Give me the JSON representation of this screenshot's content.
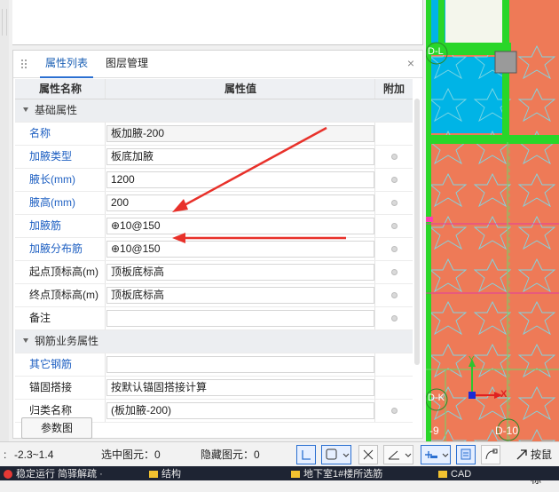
{
  "panel": {
    "tabs": [
      "属性列表",
      "图层管理"
    ],
    "close_glyph": "×",
    "columns": [
      "属性名称",
      "属性值",
      "附加"
    ],
    "sections": [
      {
        "title": "基础属性",
        "rows": [
          {
            "name": "名称",
            "value": "板加腋-200",
            "name_color": "blue",
            "has_dot": false
          },
          {
            "name": "加腋类型",
            "value": "板底加腋",
            "name_color": "blue",
            "has_dot": true
          },
          {
            "name": "腋长(mm)",
            "value": "1200",
            "name_color": "blue",
            "has_dot": true
          },
          {
            "name": "腋高(mm)",
            "value": "200",
            "name_color": "blue",
            "has_dot": true
          },
          {
            "name": "加腋筋",
            "value": "⊕10@150",
            "name_color": "blue",
            "has_dot": true
          },
          {
            "name": "加腋分布筋",
            "value": "⊕10@150",
            "name_color": "blue",
            "has_dot": true
          },
          {
            "name": "起点顶标高(m)",
            "value": "顶板底标高",
            "name_color": "black",
            "has_dot": true
          },
          {
            "name": "终点顶标高(m)",
            "value": "顶板底标高",
            "name_color": "black",
            "has_dot": true
          },
          {
            "name": "备注",
            "value": "",
            "name_color": "black",
            "has_dot": true
          }
        ]
      },
      {
        "title": "钢筋业务属性",
        "rows": [
          {
            "name": "其它钢筋",
            "value": "",
            "name_color": "blue",
            "has_dot": false
          },
          {
            "name": "锚固搭接",
            "value": "按默认锚固搭接计算",
            "name_color": "black",
            "has_dot": false
          },
          {
            "name": "归类名称",
            "value": "(板加腋-200)",
            "name_color": "black",
            "has_dot": true
          }
        ]
      }
    ],
    "param_button": "参数图"
  },
  "cad": {
    "labels": [
      "D-L",
      "D-K",
      "-9",
      "D-10"
    ],
    "axis_labels": {
      "x": "X",
      "y": "Y"
    }
  },
  "status": {
    "coord": "-2.3~1.4",
    "selected_label": "选中图元：0",
    "hidden_label": "隐藏图元：0",
    "snap_label": "按鼠标"
  },
  "taskbar": {
    "items": [
      "稳定运行 简驿解疏 ·",
      "结构",
      "地下室1#楼所选筋",
      "CAD"
    ]
  },
  "colors": {
    "accent": "#2a6fd1",
    "cad_orange": "#ee7a57",
    "cad_cyan": "#00b4e6",
    "cad_green": "#29d629",
    "arrow_red": "#e8312a"
  }
}
